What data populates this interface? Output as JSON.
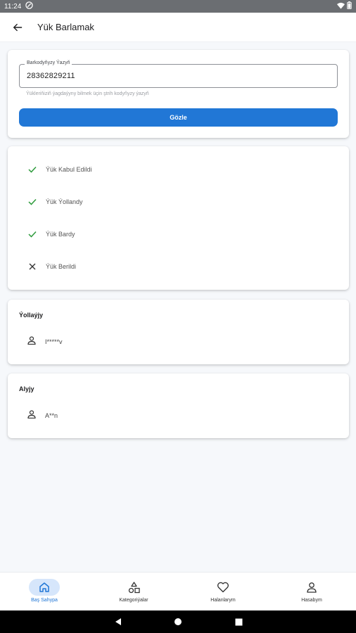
{
  "status_bar": {
    "time": "11:24"
  },
  "app_bar": {
    "title": "Yük Barlamak"
  },
  "search": {
    "field_label": "Barkodyňyzy Ýazyň",
    "field_value": "28362829211",
    "helper": "Ýükleriňiziň ýagdaýyny bilmek üçin ştrih kodyňyzy ýazyň",
    "button_label": "Gözle"
  },
  "statuses": [
    {
      "label": "Ýük Kabul Edildi",
      "state": "done"
    },
    {
      "label": "Ýük Ýollandy",
      "state": "done"
    },
    {
      "label": "Ýük Bardy",
      "state": "done"
    },
    {
      "label": "Ýük Berildi",
      "state": "pending"
    }
  ],
  "sender": {
    "title": "Ýollaýjy",
    "name": "I*****v"
  },
  "receiver": {
    "title": "Alyjy",
    "name": "A**n"
  },
  "bottom_nav": [
    {
      "label": "Baş Sahypa",
      "icon": "home-icon",
      "active": true
    },
    {
      "label": "Kategoriýalar",
      "icon": "categories-icon",
      "active": false
    },
    {
      "label": "Halanlarym",
      "icon": "heart-icon",
      "active": false
    },
    {
      "label": "Hasabym",
      "icon": "account-icon",
      "active": false
    }
  ],
  "colors": {
    "accent": "#2177d6",
    "check": "#2e9b3c",
    "active_pill": "#d6e6fb"
  }
}
